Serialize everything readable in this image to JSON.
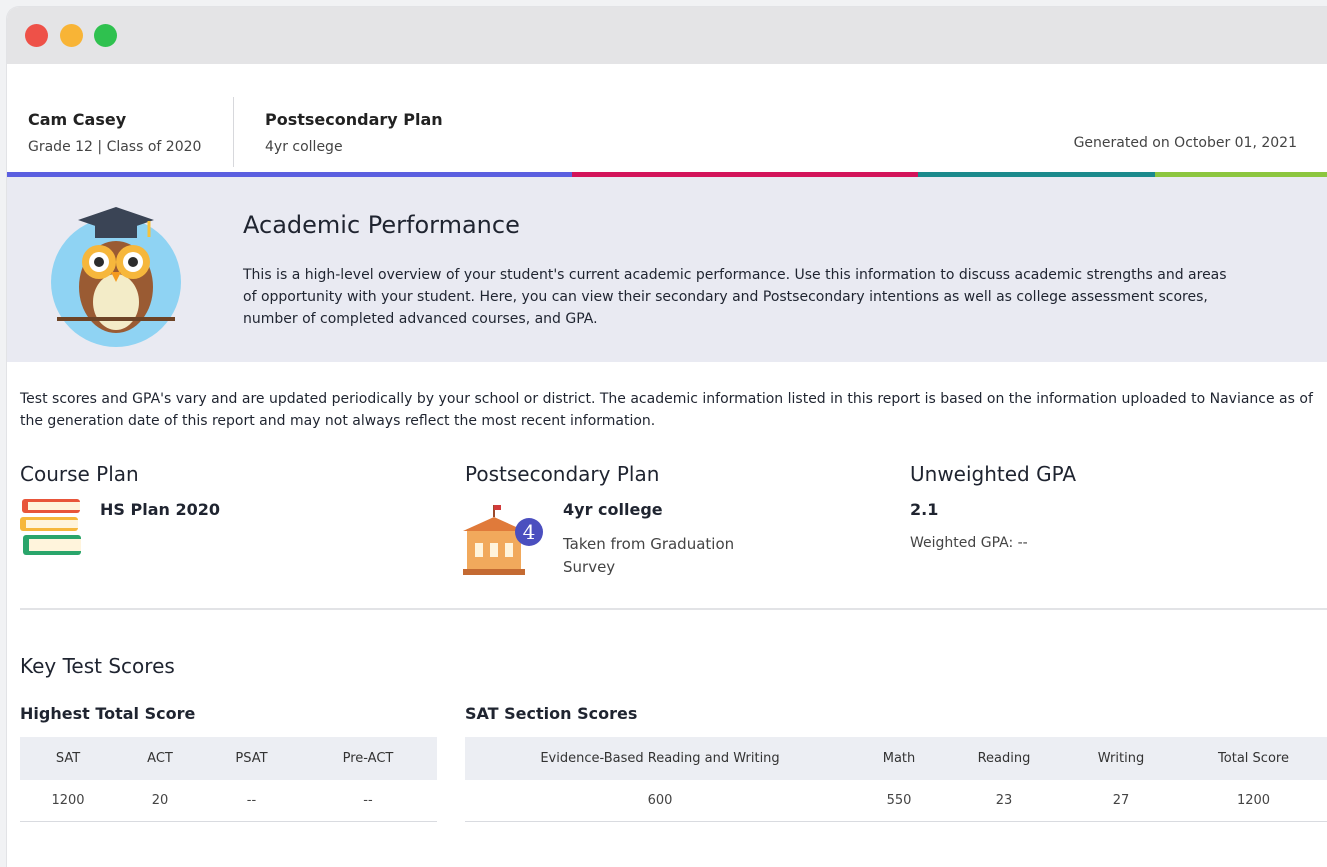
{
  "student": {
    "name": "Cam Casey",
    "grade_line": "Grade 12 | Class of 2020",
    "plan_title": "Postsecondary Plan",
    "plan_value": "4yr college",
    "generated": "Generated on October 01, 2021"
  },
  "banner": {
    "title": "Academic Performance",
    "text": "This is a high-level overview of your student's current academic performance. Use this information to discuss academic strengths and areas of opportunity with your student. Here, you can view their secondary and Postsecondary intentions as well as college assessment scores, number of completed advanced courses, and GPA."
  },
  "notice": "Test scores and GPA's vary and are updated periodically by your school or district. The academic information listed in this report is based on the information uploaded to Naviance as of the generation date of this report and may not always reflect the most recent information.",
  "course_plan": {
    "title": "Course Plan",
    "value": "HS Plan 2020"
  },
  "postsecondary": {
    "title": "Postsecondary Plan",
    "badge": "4",
    "value": "4yr college",
    "sub": "Taken from Graduation Survey"
  },
  "gpa": {
    "title": "Unweighted GPA",
    "value": "2.1",
    "weighted": "Weighted GPA: --"
  },
  "key_scores": {
    "title": "Key Test Scores",
    "highest_title": "Highest Total Score",
    "highest_headers": [
      "SAT",
      "ACT",
      "PSAT",
      "Pre-ACT"
    ],
    "highest_values": [
      "1200",
      "20",
      "--",
      "--"
    ],
    "sat_title": "SAT Section Scores",
    "sat_headers": [
      "Evidence-Based Reading and Writing",
      "Math",
      "Reading",
      "Writing",
      "Total Score"
    ],
    "sat_values": [
      "600",
      "550",
      "23",
      "27",
      "1200"
    ]
  },
  "colors": {
    "bar_blue": "#5b5fe0",
    "bar_red": "#d3145a",
    "bar_teal": "#1b8a8c",
    "bar_green": "#8cc63f",
    "badge": "#4b4fbf"
  }
}
